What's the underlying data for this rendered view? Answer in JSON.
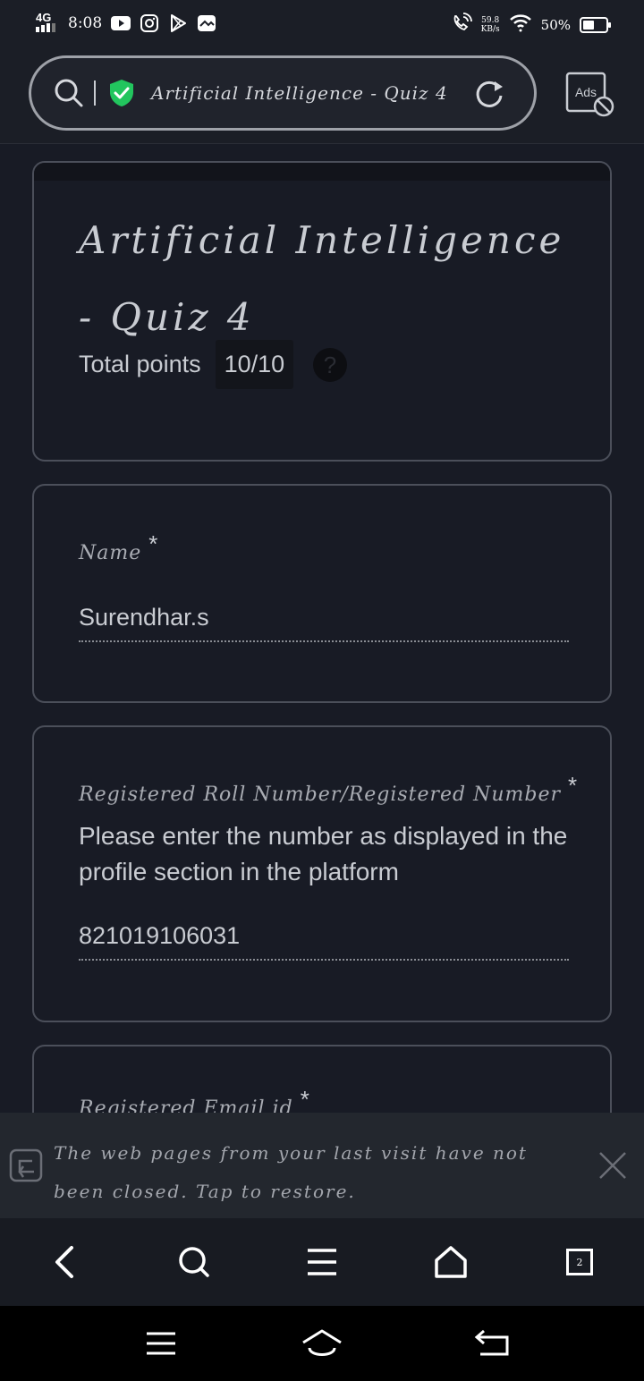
{
  "status_bar": {
    "network": "4G",
    "time": "8:08",
    "speed_value": "59.8",
    "speed_unit": "KB/s",
    "battery_percent": "50%",
    "battery_level": 0.5
  },
  "address_bar": {
    "page_title": "Artificial Intelligence - Quiz 4",
    "ads_label": "Ads"
  },
  "form": {
    "title": "Artificial Intelligence - Quiz 4",
    "total_points_label": "Total points",
    "total_points_value": "10/10",
    "help_symbol": "?"
  },
  "questions": [
    {
      "label": "Name",
      "required_mark": "*",
      "answer": "Surendhar.s"
    },
    {
      "label": "Registered Roll Number/Registered Number",
      "required_mark": "*",
      "help_text": "Please enter the number as displayed in the profile section in the platform",
      "answer": "821019106031"
    },
    {
      "label": "Registered Email id",
      "required_mark": "*"
    }
  ],
  "restore_banner": {
    "message": "The web pages from your last visit have not been closed. Tap to restore."
  },
  "toolbar": {
    "tab_count": "2"
  },
  "icons": {
    "search": "search-icon",
    "shield": "shield-check-icon",
    "reload": "reload-icon",
    "ads": "ads-block-icon",
    "help": "help-icon",
    "restore": "restore-icon",
    "close": "close-icon",
    "back": "back-icon",
    "menu": "menu-icon",
    "home": "home-icon"
  },
  "colors": {
    "background": "#181b25",
    "card_border": "#4b4f5a",
    "shield_green": "#22c55e",
    "text": "#c9ccd2"
  }
}
